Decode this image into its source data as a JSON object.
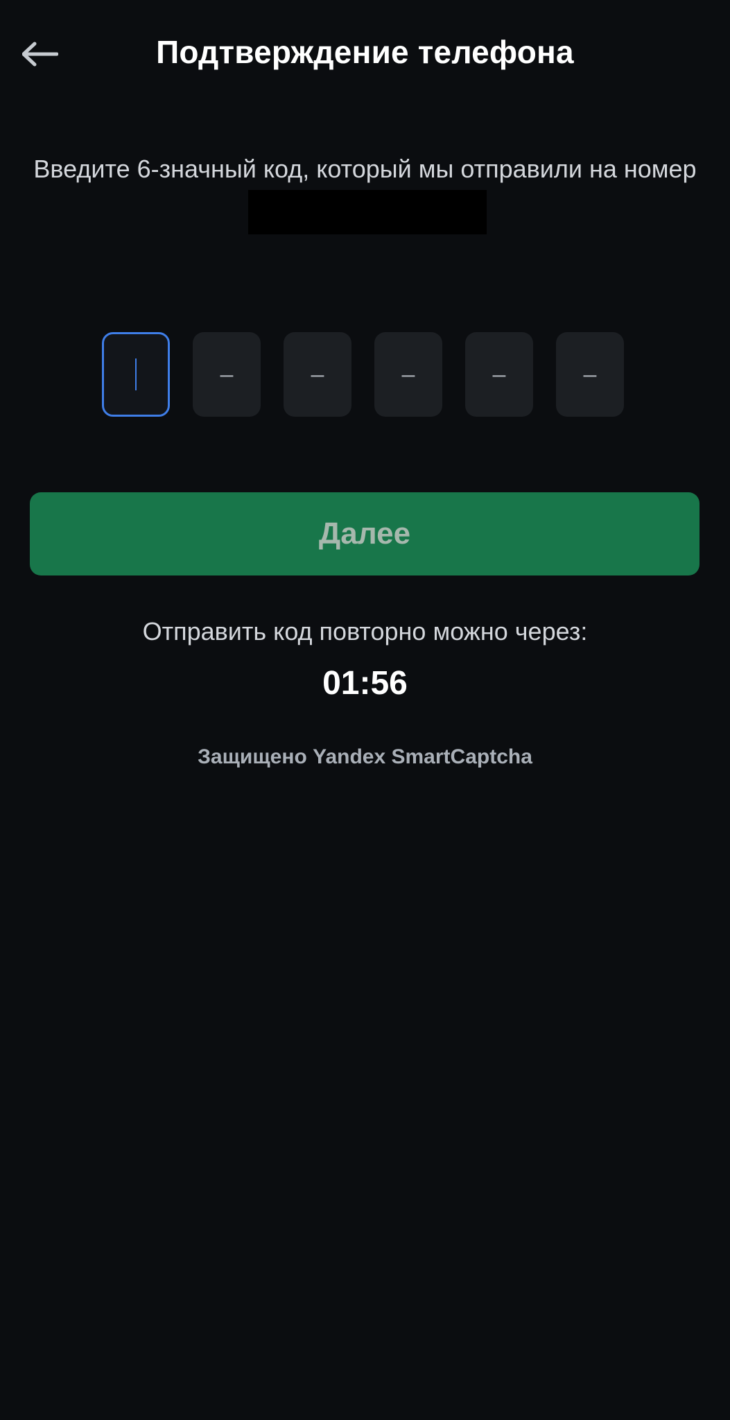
{
  "header": {
    "back_icon": "arrow-left-icon",
    "title": "Подтверждение телефона"
  },
  "instruction": {
    "text": "Введите 6-значный код, который мы отправили на номер"
  },
  "code_input": {
    "length": 6,
    "active_index": 0,
    "placeholder_char": "–",
    "digits": [
      "",
      "",
      "",
      "",
      "",
      ""
    ]
  },
  "next_button": {
    "label": "Далее"
  },
  "resend": {
    "text": "Отправить код повторно можно через:",
    "timer": "01:56"
  },
  "footer": {
    "captcha_text": "Защищено Yandex SmartCaptcha"
  },
  "colors": {
    "background": "#0b0d10",
    "accent": "#3f7ee8",
    "button": "#18764a",
    "input_bg": "#1c1f23"
  }
}
